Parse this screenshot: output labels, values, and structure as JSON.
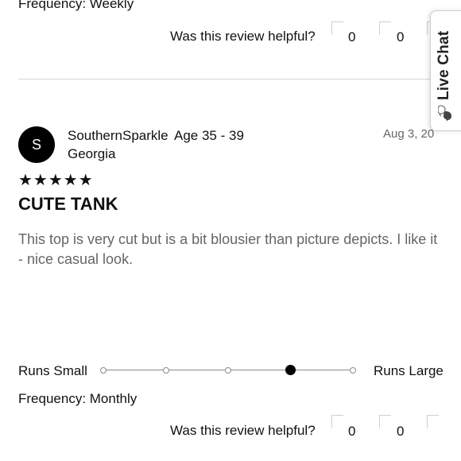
{
  "prev_review": {
    "frequency": "Frequency: Weekly",
    "helpful": {
      "question": "Was this review helpful?",
      "yes_count": "0",
      "no_count": "0"
    }
  },
  "review": {
    "avatar_initial": "S",
    "username": "SouthernSparkle",
    "age": "Age 35 - 39",
    "location": "Georgia",
    "date": "Aug 3, 20",
    "stars": "★★★★★",
    "rating": 5,
    "title": "CUTE TANK",
    "body": "This top is very cut but is a bit blousier than picture depicts. I like it - nice casual look.",
    "fit": {
      "label_small": "Runs Small",
      "label_large": "Runs Large",
      "steps": 5,
      "selected_step": 4
    },
    "frequency": "Frequency: Monthly",
    "helpful": {
      "question": "Was this review helpful?",
      "yes_count": "0",
      "no_count": "0"
    }
  },
  "live_chat": {
    "label": "Live Chat",
    "icon": "chat-bubbles-icon"
  }
}
